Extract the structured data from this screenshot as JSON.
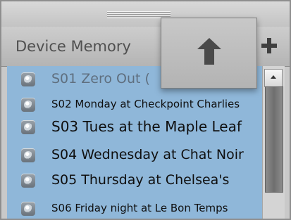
{
  "panel": {
    "title": "Device Memory",
    "add_button_icon": "plus-icon",
    "upload_button_icon": "arrow-up-icon"
  },
  "list": {
    "items": [
      {
        "label": "S01 Zero Out (",
        "icon": "disc-icon"
      },
      {
        "label": "S02 Monday at Checkpoint Charlies",
        "icon": "disc-icon"
      },
      {
        "label": "S03 Tues at the Maple Leaf",
        "icon": "disc-icon"
      },
      {
        "label": "S04 Wednesday at Chat Noir",
        "icon": "disc-icon"
      },
      {
        "label": "S05 Thursday at Chelsea's",
        "icon": "disc-icon"
      },
      {
        "label": "S06 Friday night at Le Bon Temps",
        "icon": "disc-icon"
      }
    ]
  },
  "colors": {
    "list_background": "#8fb7d9",
    "header_text": "#505050",
    "first_item_text": "#5f6f7f"
  }
}
